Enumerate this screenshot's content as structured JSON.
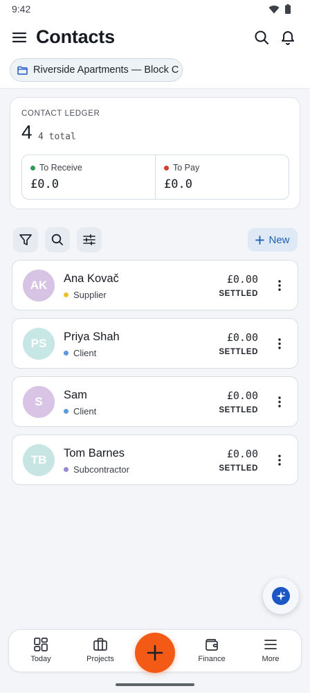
{
  "status": {
    "time": "9:42"
  },
  "appbar": {
    "title": "Contacts"
  },
  "project_chip": {
    "label": "Riverside Apartments — Block C"
  },
  "ledger": {
    "label": "CONTACT LEDGER",
    "count": "4",
    "total_text": "4 total",
    "receive": {
      "label": "To Receive",
      "value": "£0.0",
      "color": "#2e9a56"
    },
    "pay": {
      "label": "To Pay",
      "value": "£0.0",
      "color": "#d63a2e"
    }
  },
  "toolbar": {
    "new_label": "New"
  },
  "contacts": [
    {
      "initials": "AK",
      "name": "Ana Kovač",
      "role": "Supplier",
      "role_color": "#e8c227",
      "avatar_color": "#d7c3e3",
      "amount": "£0.00",
      "status": "SETTLED"
    },
    {
      "initials": "PS",
      "name": "Priya Shah",
      "role": "Client",
      "role_color": "#5b9ae0",
      "avatar_color": "#c7e6e6",
      "amount": "£0.00",
      "status": "SETTLED"
    },
    {
      "initials": "S",
      "name": "Sam",
      "role": "Client",
      "role_color": "#5b9ae0",
      "avatar_color": "#d9c4e6",
      "amount": "£0.00",
      "status": "SETTLED"
    },
    {
      "initials": "TB",
      "name": "Tom Barnes",
      "role": "Subcontractor",
      "role_color": "#9a86d6",
      "avatar_color": "#c7e6e3",
      "amount": "£0.00",
      "status": "SETTLED"
    }
  ],
  "nav": {
    "today": "Today",
    "projects": "Projects",
    "finance": "Finance",
    "more": "More"
  },
  "colors": {
    "accent": "#f25a16",
    "brand_blue": "#1a56c4"
  }
}
